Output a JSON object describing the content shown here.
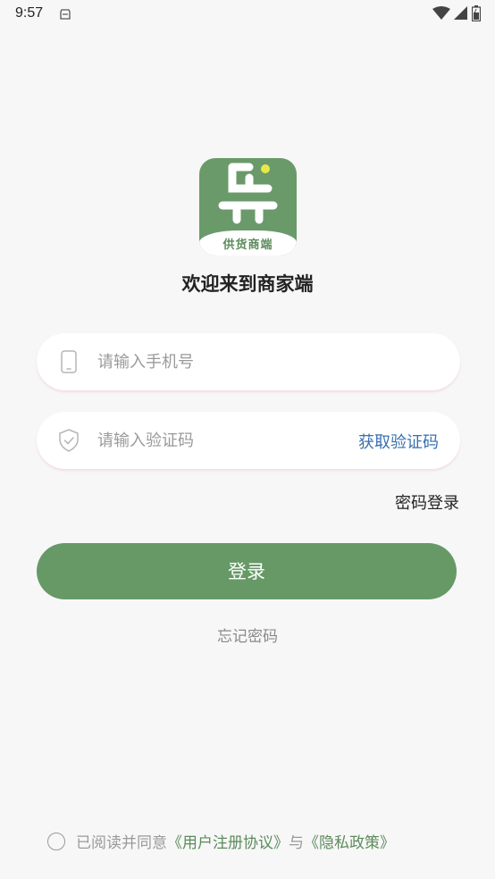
{
  "status_bar": {
    "time": "9:57"
  },
  "logo": {
    "label": "供货商端",
    "brand_color": "#6a9a6a"
  },
  "welcome_text": "欢迎来到商家端",
  "phone_field": {
    "placeholder": "请输入手机号",
    "value": ""
  },
  "code_field": {
    "placeholder": "请输入验证码",
    "value": "",
    "get_code_label": "获取验证码"
  },
  "password_login_label": "密码登录",
  "login_button_label": "登录",
  "forgot_password_label": "忘记密码",
  "agreement": {
    "prefix": "已阅读并同意",
    "user_agreement": "《用户注册协议》",
    "conjunction": "与",
    "privacy_policy": "《隐私政策》",
    "checked": false
  },
  "colors": {
    "accent": "#669966",
    "link": "#3a6fb0"
  }
}
